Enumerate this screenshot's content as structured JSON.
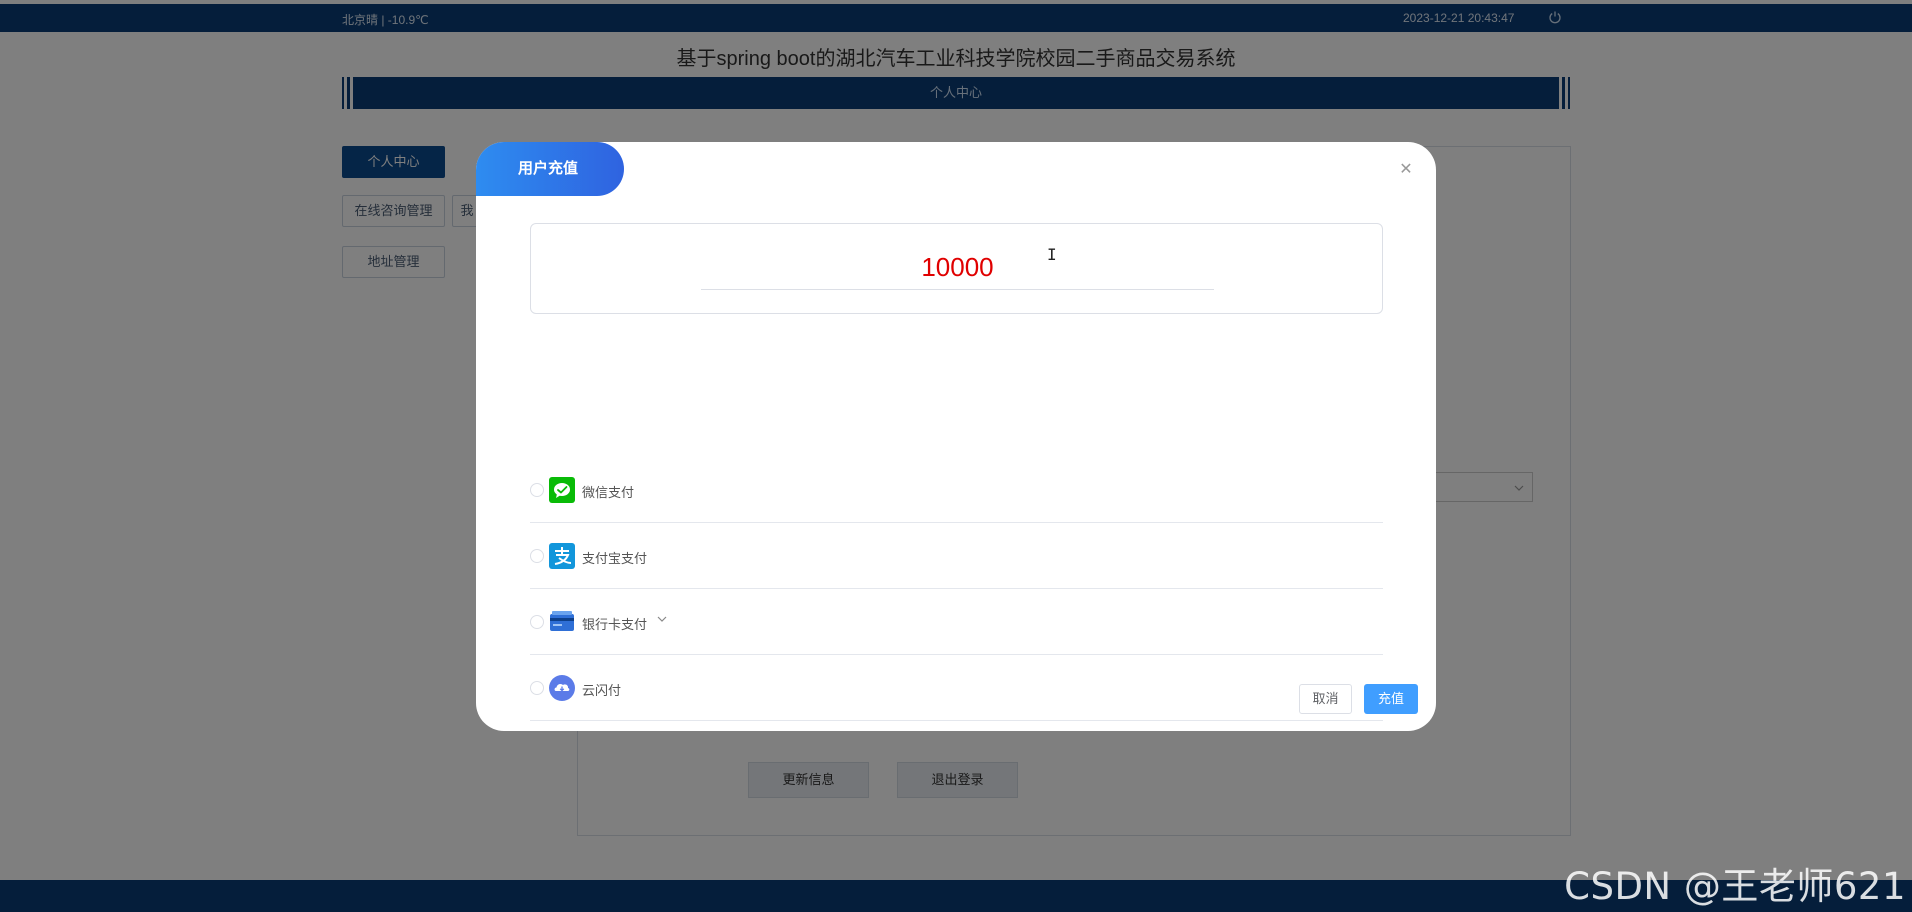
{
  "topbar": {
    "weather": "北京晴 | -10.9℃",
    "datetime": "2023-12-21   20:43:47",
    "power_icon": "power-icon"
  },
  "site_title": "基于spring boot的湖北汽车工业科技学院校园二手商品交易系统",
  "section_title": "个人中心",
  "side_menu": {
    "personal_center": "个人中心",
    "online_consult": "在线咨询管理",
    "partial_item": "我",
    "address": "地址管理"
  },
  "bg_buttons": {
    "update": "更新信息",
    "logout": "退出登录"
  },
  "modal": {
    "title": "用户充值",
    "close_icon": "close-icon",
    "amount": "10000",
    "payment_options": [
      {
        "label": "微信支付",
        "icon": "wechat-pay-icon"
      },
      {
        "label": "支付宝支付",
        "icon": "alipay-icon"
      },
      {
        "label": "银行卡支付",
        "icon": "bank-card-icon"
      },
      {
        "label": "云闪付",
        "icon": "unionpay-cloud-icon"
      }
    ],
    "cancel": "取消",
    "confirm": "充值"
  },
  "watermark": "CSDN @王老师621",
  "colors": {
    "navy": "#0b3d76",
    "primary": "#409eff",
    "amount_red": "#e00000",
    "tab_gradient_start": "#2e8cf0",
    "tab_gradient_end": "#2f63e0",
    "wechat_green": "#09bb07",
    "alipay_blue": "#1296db"
  }
}
